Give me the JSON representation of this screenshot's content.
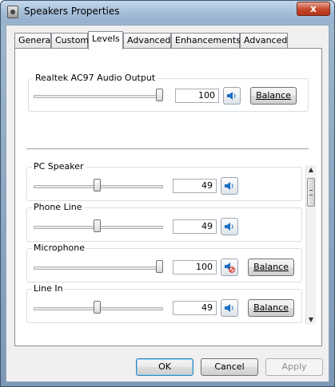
{
  "window": {
    "title": "Speakers Properties",
    "close_glyph": "x"
  },
  "tabs": [
    "General",
    "Custom",
    "Levels",
    "Advanced",
    "Enhancements",
    "Advanced"
  ],
  "active_tab": "Levels",
  "master": {
    "label": "Realtek AC97 Audio Output",
    "value": "100",
    "level": 1.0,
    "balance_label": "Balance",
    "muted": false
  },
  "channels": [
    {
      "label": "PC Speaker",
      "value": "49",
      "level": 0.49,
      "muted": false,
      "has_balance": false
    },
    {
      "label": "Phone Line",
      "value": "49",
      "level": 0.49,
      "muted": false,
      "has_balance": false
    },
    {
      "label": "Microphone",
      "value": "100",
      "level": 1.0,
      "muted": true,
      "has_balance": true,
      "balance_label": "Balance"
    },
    {
      "label": "Line In",
      "value": "49",
      "level": 0.49,
      "muted": false,
      "has_balance": true,
      "balance_label": "Balance"
    }
  ],
  "footer": {
    "ok": "OK",
    "cancel": "Cancel",
    "apply": "Apply"
  },
  "colors": {
    "muted_indicator": "#d23b2a",
    "speaker_blue": "#1c6fc4"
  }
}
